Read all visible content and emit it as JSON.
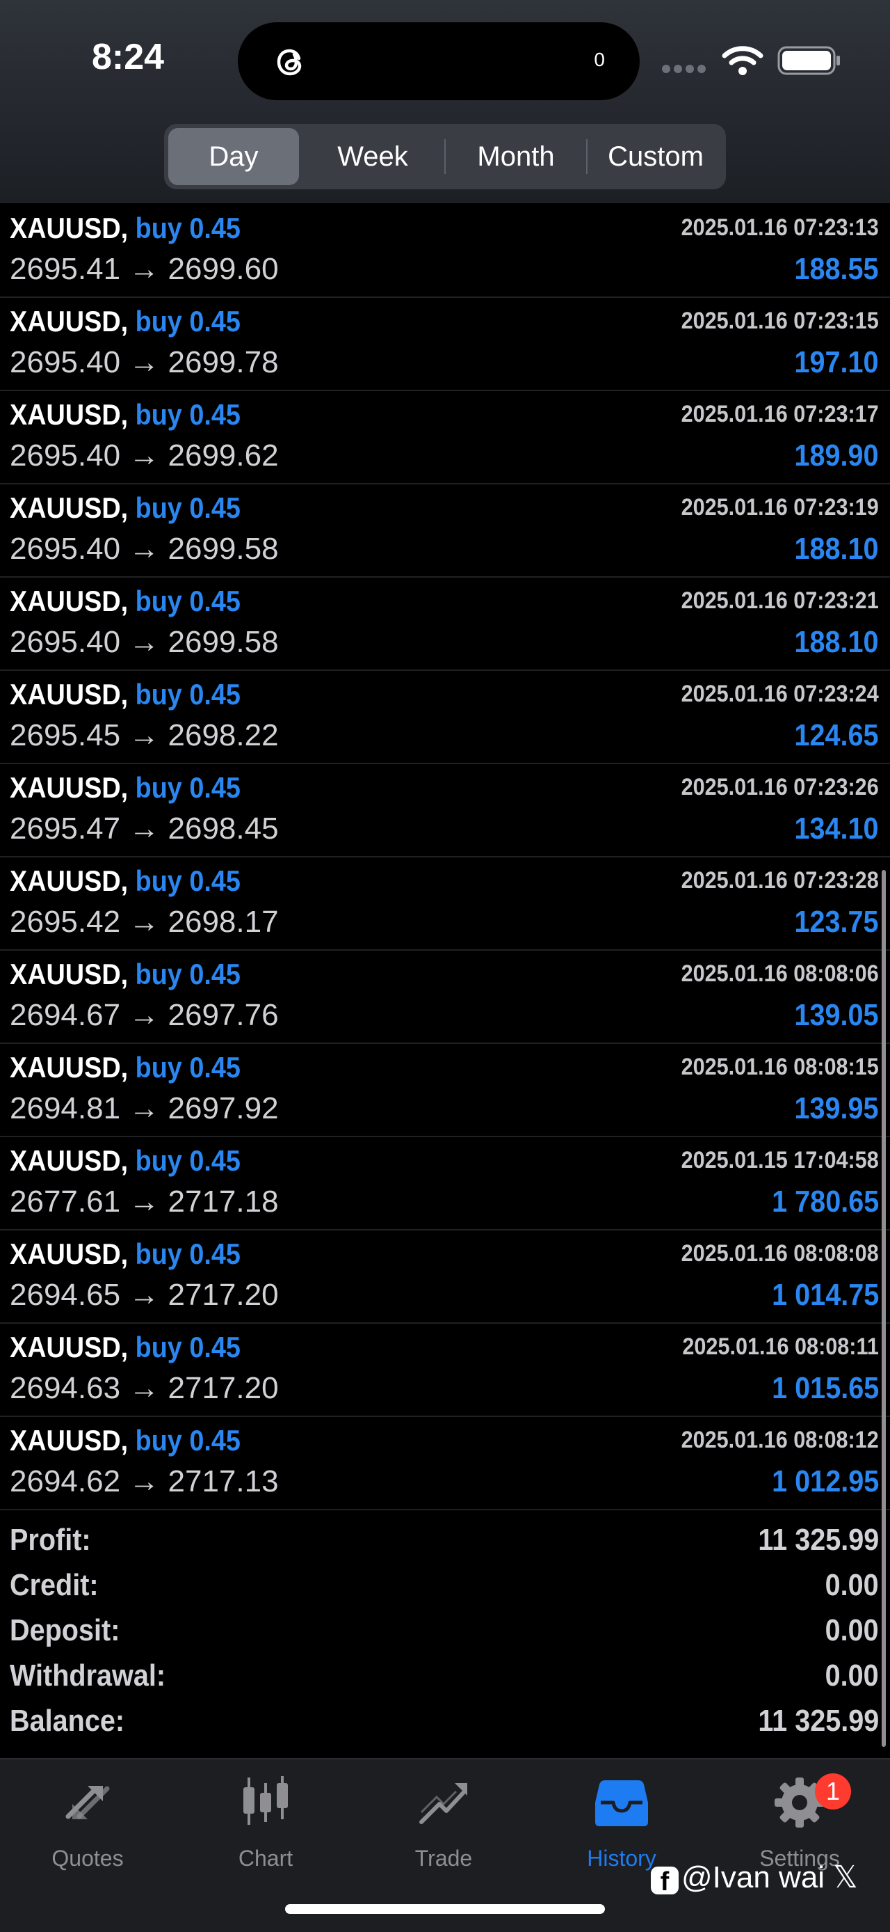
{
  "status_bar": {
    "time": "8:24",
    "notification_count": "0"
  },
  "period_tabs": [
    {
      "label": "Day",
      "active": true
    },
    {
      "label": "Week",
      "active": false
    },
    {
      "label": "Month",
      "active": false
    },
    {
      "label": "Custom",
      "active": false
    }
  ],
  "deals": [
    {
      "symbol": "XAUUSD,",
      "action": "buy 0.45",
      "datetime": "2025.01.16 07:23:13",
      "prices": "2695.41 → 2699.60",
      "profit": "188.55"
    },
    {
      "symbol": "XAUUSD,",
      "action": "buy 0.45",
      "datetime": "2025.01.16 07:23:15",
      "prices": "2695.40 → 2699.78",
      "profit": "197.10"
    },
    {
      "symbol": "XAUUSD,",
      "action": "buy 0.45",
      "datetime": "2025.01.16 07:23:17",
      "prices": "2695.40 → 2699.62",
      "profit": "189.90"
    },
    {
      "symbol": "XAUUSD,",
      "action": "buy 0.45",
      "datetime": "2025.01.16 07:23:19",
      "prices": "2695.40 → 2699.58",
      "profit": "188.10"
    },
    {
      "symbol": "XAUUSD,",
      "action": "buy 0.45",
      "datetime": "2025.01.16 07:23:21",
      "prices": "2695.40 → 2699.58",
      "profit": "188.10"
    },
    {
      "symbol": "XAUUSD,",
      "action": "buy 0.45",
      "datetime": "2025.01.16 07:23:24",
      "prices": "2695.45 → 2698.22",
      "profit": "124.65"
    },
    {
      "symbol": "XAUUSD,",
      "action": "buy 0.45",
      "datetime": "2025.01.16 07:23:26",
      "prices": "2695.47 → 2698.45",
      "profit": "134.10"
    },
    {
      "symbol": "XAUUSD,",
      "action": "buy 0.45",
      "datetime": "2025.01.16 07:23:28",
      "prices": "2695.42 → 2698.17",
      "profit": "123.75"
    },
    {
      "symbol": "XAUUSD,",
      "action": "buy 0.45",
      "datetime": "2025.01.16 08:08:06",
      "prices": "2694.67 → 2697.76",
      "profit": "139.05"
    },
    {
      "symbol": "XAUUSD,",
      "action": "buy 0.45",
      "datetime": "2025.01.16 08:08:15",
      "prices": "2694.81 → 2697.92",
      "profit": "139.95"
    },
    {
      "symbol": "XAUUSD,",
      "action": "buy 0.45",
      "datetime": "2025.01.15 17:04:58",
      "prices": "2677.61 → 2717.18",
      "profit": "1 780.65"
    },
    {
      "symbol": "XAUUSD,",
      "action": "buy 0.45",
      "datetime": "2025.01.16 08:08:08",
      "prices": "2694.65 → 2717.20",
      "profit": "1 014.75"
    },
    {
      "symbol": "XAUUSD,",
      "action": "buy 0.45",
      "datetime": "2025.01.16 08:08:11",
      "prices": "2694.63 → 2717.20",
      "profit": "1 015.65"
    },
    {
      "symbol": "XAUUSD,",
      "action": "buy 0.45",
      "datetime": "2025.01.16 08:08:12",
      "prices": "2694.62 → 2717.13",
      "profit": "1 012.95"
    }
  ],
  "summary": [
    {
      "label": "Profit:",
      "value": "11 325.99"
    },
    {
      "label": "Credit:",
      "value": "0.00"
    },
    {
      "label": "Deposit:",
      "value": "0.00"
    },
    {
      "label": "Withdrawal:",
      "value": "0.00"
    },
    {
      "label": "Balance:",
      "value": "11 325.99"
    }
  ],
  "tabbar": [
    {
      "label": "Quotes",
      "icon": "quotes-icon",
      "active": false
    },
    {
      "label": "Chart",
      "icon": "chart-icon",
      "active": false
    },
    {
      "label": "Trade",
      "icon": "trade-icon",
      "active": false
    },
    {
      "label": "History",
      "icon": "history-icon",
      "active": true
    },
    {
      "label": "Settings",
      "icon": "gear-icon",
      "active": false,
      "badge": "1"
    }
  ],
  "watermark": "@Ivan wai 𝕏",
  "colors": {
    "accent_blue": "#2a86f0",
    "tab_active": "#1e7cf2",
    "badge_red": "#ff3b30",
    "background": "#000000"
  }
}
